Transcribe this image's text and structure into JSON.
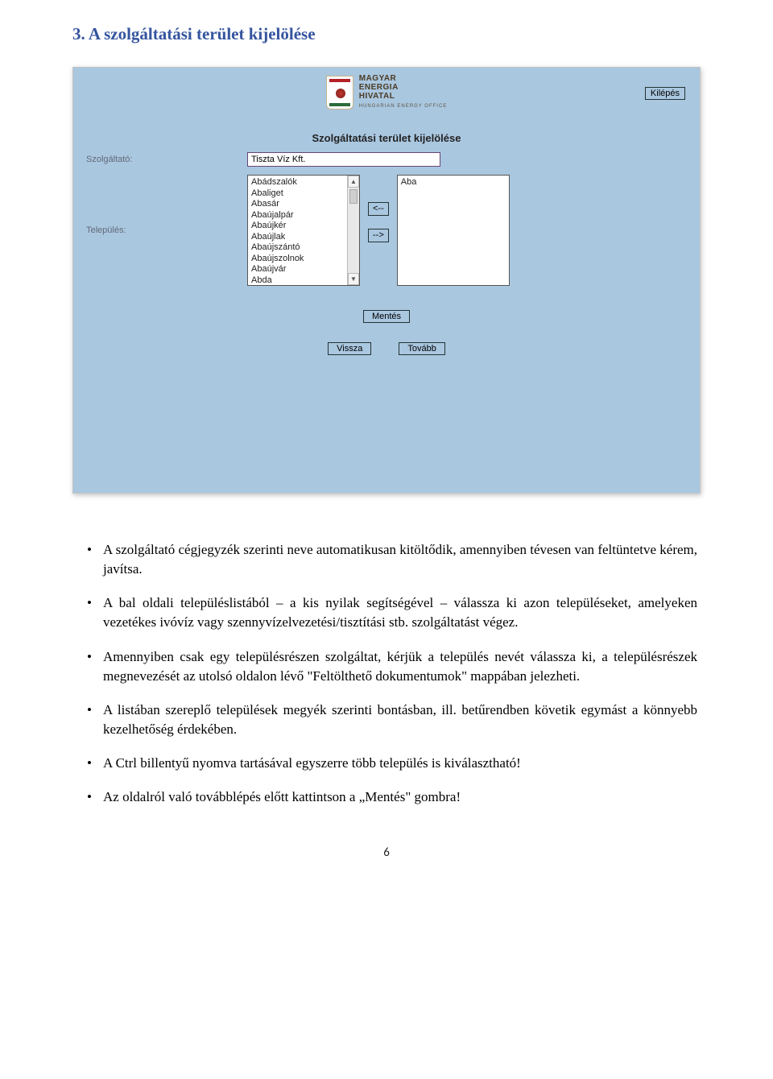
{
  "section_heading": "3. A szolgáltatási terület kijelölése",
  "app": {
    "logo_line1": "MAGYAR",
    "logo_line2": "ENERGIA",
    "logo_line3": "HIVATAL",
    "logo_sub": "HUNGARIAN ENERGY OFFICE",
    "exit_label": "Kilépés",
    "page_title": "Szolgáltatási terület kijelölése",
    "provider_label": "Szolgáltató:",
    "provider_value": "Tiszta Víz Kft.",
    "settlement_label": "Település:",
    "settlements_left": [
      "Abádszalók",
      "Abaliget",
      "Abasár",
      "Abaújalpár",
      "Abaújkér",
      "Abaújlak",
      "Abaújszántó",
      "Abaújszolnok",
      "Abaújvár",
      "Abda"
    ],
    "settlements_right": [
      "Aba"
    ],
    "arrow_left": "<--",
    "arrow_right": "-->",
    "save_label": "Mentés",
    "back_label": "Vissza",
    "next_label": "Tovább"
  },
  "bullets": [
    "A szolgáltató cégjegyzék szerinti neve automatikusan kitöltődik, amennyiben tévesen van feltüntetve kérem, javítsa.",
    "A bal oldali településlistából – a kis nyilak segítségével – válassza ki azon településeket, amelyeken vezetékes ivóvíz vagy szennyvízelvezetési/tisztítási stb. szolgáltatást végez.",
    "Amennyiben csak egy településrészen szolgáltat, kérjük a település nevét válassza ki, a településrészek megnevezését az utolsó oldalon lévő \"Feltölthető dokumentumok\" mappában jelezheti.",
    "A listában szereplő települések megyék szerinti bontásban, ill. betűrendben követik egymást a könnyebb kezelhetőség érdekében.",
    "A Ctrl billentyű nyomva tartásával egyszerre több település is kiválasztható!",
    "Az oldalról való továbblépés előtt kattintson a „Mentés\" gombra!"
  ],
  "page_number": "6"
}
